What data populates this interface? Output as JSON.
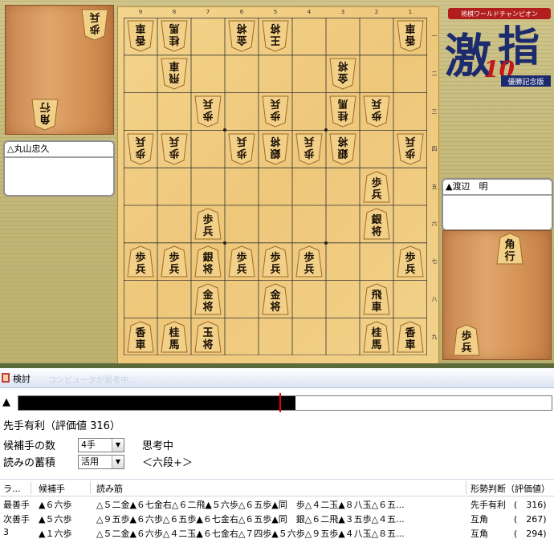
{
  "board": {
    "files": [
      "9",
      "8",
      "7",
      "6",
      "5",
      "4",
      "3",
      "2",
      "1"
    ],
    "ranks": [
      "一",
      "二",
      "三",
      "四",
      "五",
      "六",
      "七",
      "八",
      "九"
    ],
    "pieces": [
      {
        "f": 9,
        "r": 1,
        "t": "香車",
        "o": "g"
      },
      {
        "f": 8,
        "r": 1,
        "t": "桂馬",
        "o": "g"
      },
      {
        "f": 6,
        "r": 1,
        "t": "金将",
        "o": "g"
      },
      {
        "f": 5,
        "r": 1,
        "t": "王将",
        "o": "g"
      },
      {
        "f": 1,
        "r": 1,
        "t": "香車",
        "o": "g"
      },
      {
        "f": 8,
        "r": 2,
        "t": "飛車",
        "o": "g"
      },
      {
        "f": 3,
        "r": 2,
        "t": "金将",
        "o": "g"
      },
      {
        "f": 7,
        "r": 3,
        "t": "歩兵",
        "o": "g"
      },
      {
        "f": 5,
        "r": 3,
        "t": "歩兵",
        "o": "g"
      },
      {
        "f": 3,
        "r": 3,
        "t": "桂馬",
        "o": "g"
      },
      {
        "f": 2,
        "r": 3,
        "t": "歩兵",
        "o": "g"
      },
      {
        "f": 9,
        "r": 4,
        "t": "歩兵",
        "o": "g"
      },
      {
        "f": 8,
        "r": 4,
        "t": "歩兵",
        "o": "g"
      },
      {
        "f": 6,
        "r": 4,
        "t": "歩兵",
        "o": "g"
      },
      {
        "f": 5,
        "r": 4,
        "t": "銀将",
        "o": "g"
      },
      {
        "f": 4,
        "r": 4,
        "t": "歩兵",
        "o": "g"
      },
      {
        "f": 3,
        "r": 4,
        "t": "銀将",
        "o": "g"
      },
      {
        "f": 1,
        "r": 4,
        "t": "歩兵",
        "o": "g"
      },
      {
        "f": 2,
        "r": 5,
        "t": "歩兵",
        "o": "s"
      },
      {
        "f": 7,
        "r": 6,
        "t": "歩兵",
        "o": "s"
      },
      {
        "f": 2,
        "r": 6,
        "t": "銀将",
        "o": "s"
      },
      {
        "f": 9,
        "r": 7,
        "t": "歩兵",
        "o": "s"
      },
      {
        "f": 8,
        "r": 7,
        "t": "歩兵",
        "o": "s"
      },
      {
        "f": 7,
        "r": 7,
        "t": "銀将",
        "o": "s"
      },
      {
        "f": 6,
        "r": 7,
        "t": "歩兵",
        "o": "s"
      },
      {
        "f": 5,
        "r": 7,
        "t": "歩兵",
        "o": "s"
      },
      {
        "f": 4,
        "r": 7,
        "t": "歩兵",
        "o": "s"
      },
      {
        "f": 1,
        "r": 7,
        "t": "歩兵",
        "o": "s"
      },
      {
        "f": 7,
        "r": 8,
        "t": "金将",
        "o": "s"
      },
      {
        "f": 5,
        "r": 8,
        "t": "金将",
        "o": "s"
      },
      {
        "f": 2,
        "r": 8,
        "t": "飛車",
        "o": "s"
      },
      {
        "f": 9,
        "r": 9,
        "t": "香車",
        "o": "s"
      },
      {
        "f": 8,
        "r": 9,
        "t": "桂馬",
        "o": "s"
      },
      {
        "f": 7,
        "r": 9,
        "t": "玉将",
        "o": "s"
      },
      {
        "f": 2,
        "r": 9,
        "t": "桂馬",
        "o": "s"
      },
      {
        "f": 1,
        "r": 9,
        "t": "香車",
        "o": "s"
      }
    ]
  },
  "komadai": {
    "gote": [
      {
        "t": "歩兵"
      },
      {
        "t": "角行"
      }
    ],
    "sente": [
      {
        "t": "角行"
      },
      {
        "t": "歩兵"
      }
    ]
  },
  "players": {
    "gote_name": "△丸山忠久",
    "sente_name": "▲渡辺　明"
  },
  "logo": {
    "banner": "将棋ワールドチャンピオン",
    "kanji1": "激",
    "kanji2": "指",
    "number": "10",
    "sub": "優勝記念版"
  },
  "window": {
    "title": "検討",
    "blurred_text": "コンピュータが思考中..."
  },
  "evaluation": {
    "side_marker": "▲",
    "fraction": 0.52,
    "marker_fraction": 0.49,
    "summary": "先手有利（評価値 316）"
  },
  "settings": {
    "candidates_label": "候補手の数",
    "candidates_value": "4手",
    "status": "思考中",
    "reading_label": "読みの蓄積",
    "reading_value": "活用",
    "level": "＜六段+＞"
  },
  "table": {
    "headers": [
      "ラ...",
      "候補手",
      "読み筋",
      "形勢判断（評価値）"
    ],
    "rows": [
      {
        "rank": "最善手",
        "move": "▲６六歩",
        "line": "△５二金▲６七金右△６二飛▲５六歩△６五歩▲同　歩△４二玉▲８八玉△６五...",
        "judge": "先手有利",
        "score": "(　316)"
      },
      {
        "rank": "次善手",
        "move": "▲５六歩",
        "line": "△９五歩▲６六歩△６五歩▲６七金右△６五歩▲同　銀△６二飛▲３五歩△４五...",
        "judge": "互角",
        "score": "(　267)"
      },
      {
        "rank": "3",
        "move": "▲１六歩",
        "line": "△５二金▲６六歩△４二玉▲６七金右△７四歩▲５六歩△９五歩▲４八玉△８五...",
        "judge": "互角",
        "score": "(　294)"
      }
    ]
  }
}
